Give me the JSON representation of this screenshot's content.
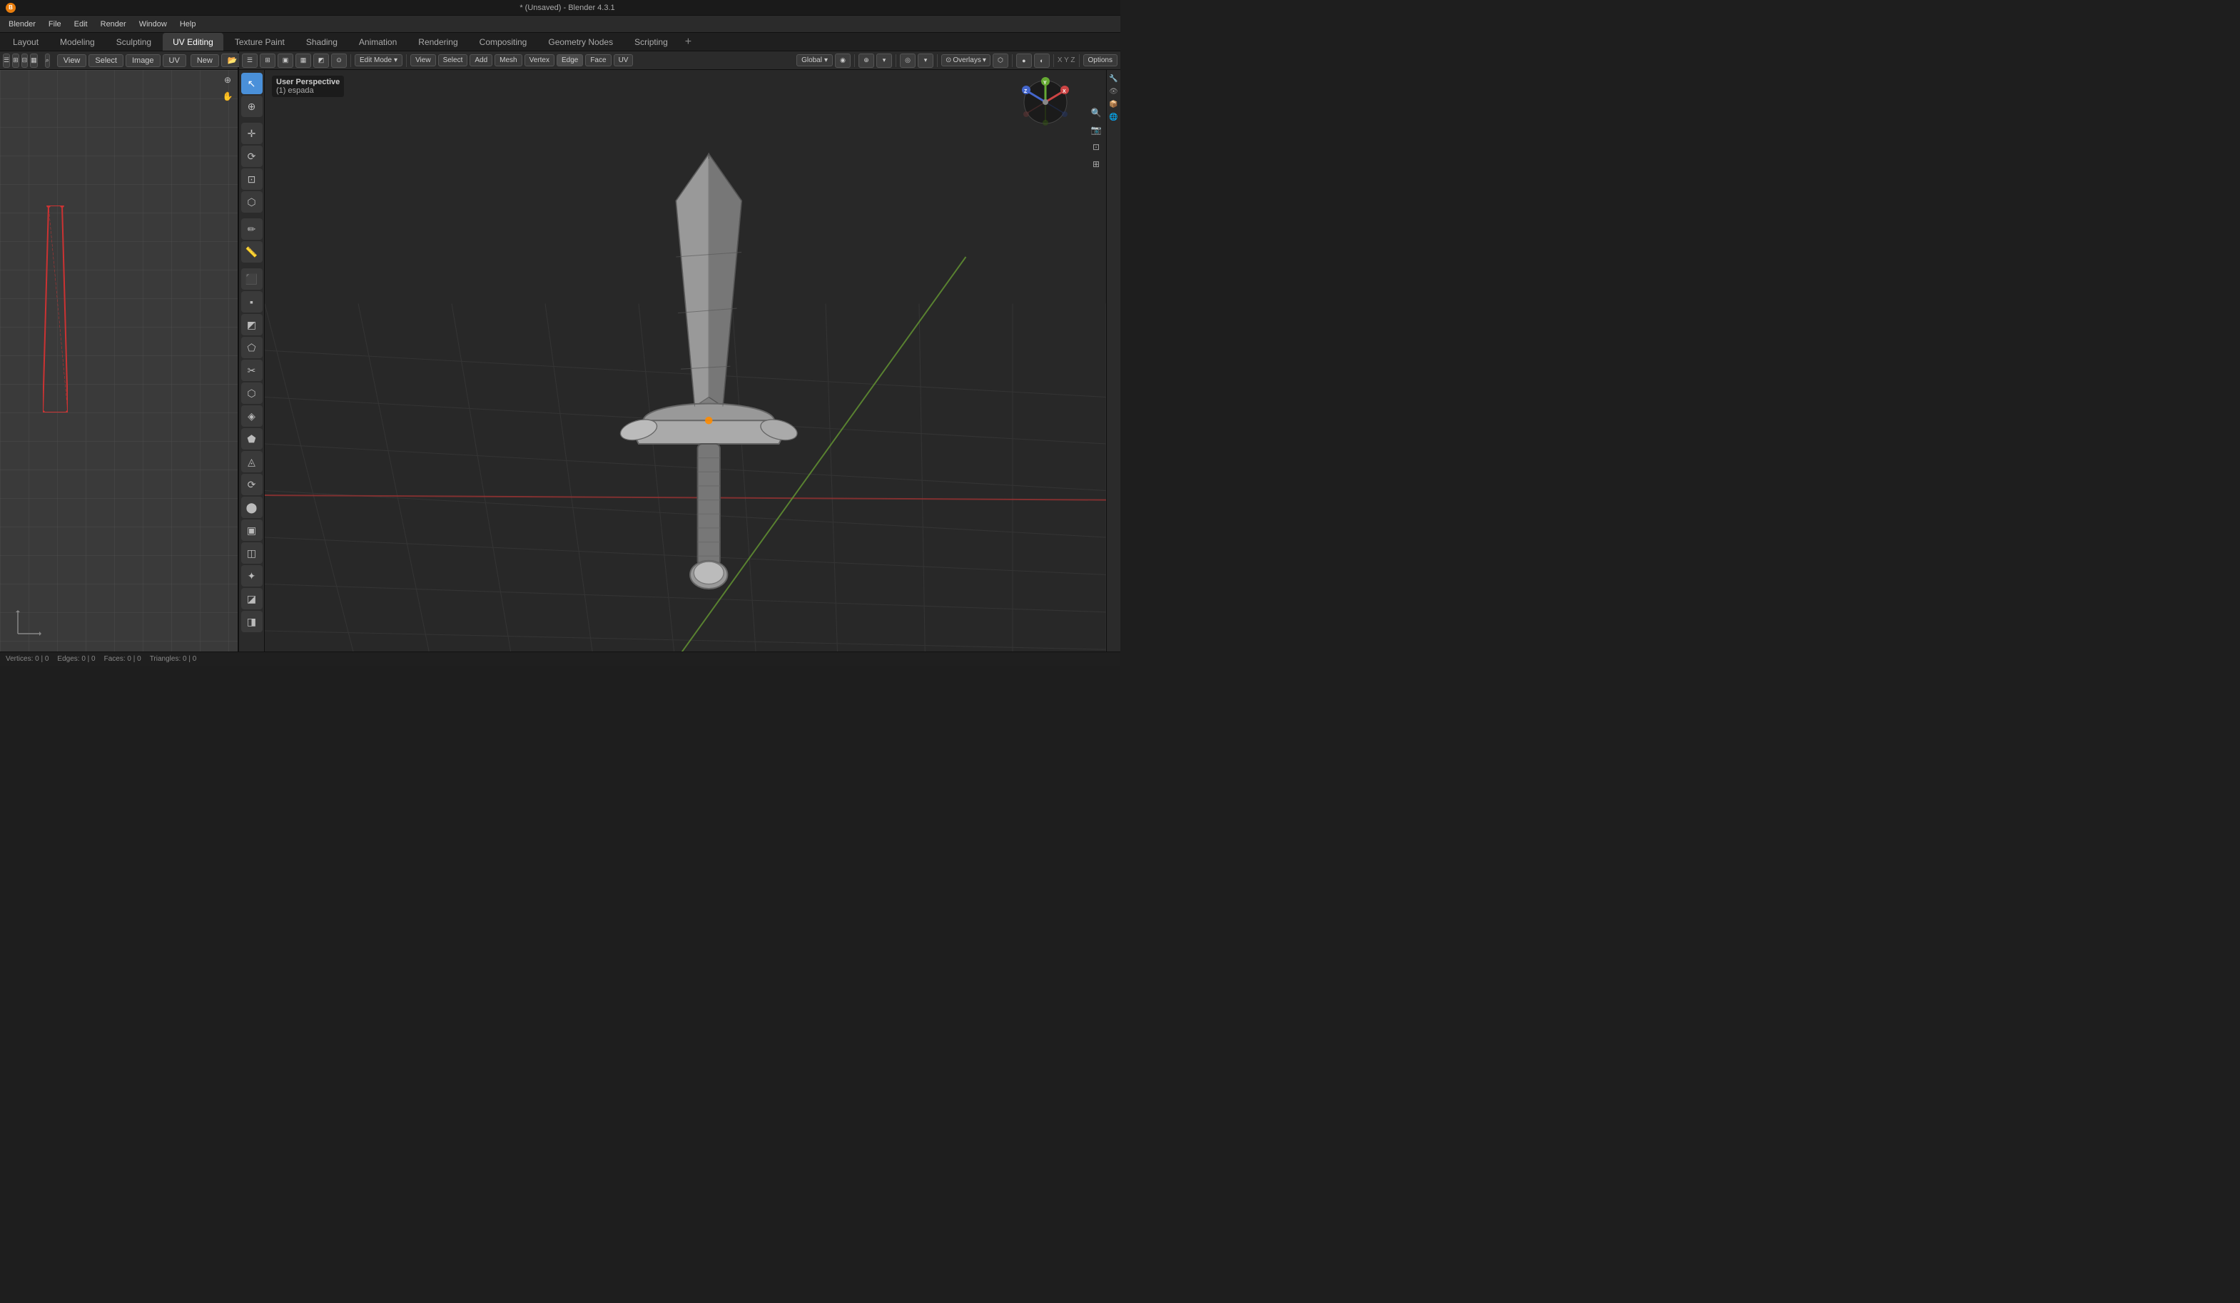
{
  "titleBar": {
    "title": "* (Unsaved) - Blender 4.3.1"
  },
  "menuBar": {
    "items": [
      "Blender",
      "File",
      "Edit",
      "Render",
      "Window",
      "Help"
    ]
  },
  "workspaceTabs": {
    "tabs": [
      "Layout",
      "Modeling",
      "Sculpting",
      "UV Editing",
      "Texture Paint",
      "Shading",
      "Animation",
      "Rendering",
      "Compositing",
      "Geometry Nodes",
      "Scripting"
    ],
    "activeTab": "UV Editing"
  },
  "uvEditor": {
    "title": "UV Editing",
    "viewMenu": "View",
    "selectMenu": "Select",
    "imageMenu": "Image",
    "uvMenu": "UV",
    "newBtn": "New",
    "openBtn": "Open"
  },
  "viewport3d": {
    "editMode": "Edit Mode",
    "viewMenu": "View",
    "selectMenu": "Select",
    "addMenu": "Add",
    "meshMenu": "Mesh",
    "vertexMenu": "Vertex",
    "edgeMenu": "Edge",
    "faceMenu": "Face",
    "uvMenu": "UV",
    "transformOrigin": "Global",
    "snapping": "Snapping",
    "proportional": "Proportional",
    "overlays": "Overlays",
    "xray": "X-Ray",
    "options": "Options",
    "viewportInfo": {
      "perspective": "User Perspective",
      "objectName": "(1) espada"
    },
    "coordDisplay": "X Y Z",
    "optionsBtn": "Options"
  },
  "toolSidebar": {
    "tools": [
      {
        "icon": "↖",
        "name": "select-box",
        "active": true
      },
      {
        "icon": "⊕",
        "name": "cursor"
      },
      {
        "icon": "✛",
        "name": "move"
      },
      {
        "icon": "⟳",
        "name": "rotate"
      },
      {
        "icon": "⊡",
        "name": "scale"
      },
      {
        "icon": "⬡",
        "name": "transform"
      },
      {
        "icon": "✏",
        "name": "annotate"
      },
      {
        "icon": "📐",
        "name": "measure"
      },
      {
        "icon": "⬛",
        "name": "add-box"
      },
      {
        "icon": "▪",
        "name": "extrude"
      },
      {
        "icon": "◩",
        "name": "inset"
      },
      {
        "icon": "⬠",
        "name": "bevel"
      },
      {
        "icon": "✂",
        "name": "loop-cut"
      },
      {
        "icon": "⬡",
        "name": "offset-edge"
      },
      {
        "icon": "◈",
        "name": "knife"
      },
      {
        "icon": "⬟",
        "name": "bisect"
      },
      {
        "icon": "◬",
        "name": "poly-build"
      },
      {
        "icon": "🔴",
        "name": "spin"
      },
      {
        "icon": "⬤",
        "name": "smooth"
      },
      {
        "icon": "▣",
        "name": "randomize"
      },
      {
        "icon": "⬡",
        "name": "edge-slide"
      },
      {
        "icon": "✦",
        "name": "shrink-fatten"
      },
      {
        "icon": "◪",
        "name": "push-pull"
      },
      {
        "icon": "◫",
        "name": "shear"
      }
    ]
  },
  "colors": {
    "accent": "#4a90d9",
    "background3d": "#282828",
    "backgroundUV": "#3a3a3a",
    "toolbar": "#2b2b2b",
    "activeTab": "#3d3d3d",
    "gridLine": "#3f3f3f",
    "axisX": "#cc3333",
    "axisY": "#669933",
    "axisZ": "#3366cc",
    "swordColor": "#888888",
    "swordHighlight": "#bbbbbb"
  },
  "statusBar": {
    "vertices": "Vertices: 0 | 0",
    "edges": "Edges: 0 | 0",
    "faces": "Faces: 0 | 0",
    "triangles": "Triangles: 0 | 0"
  }
}
